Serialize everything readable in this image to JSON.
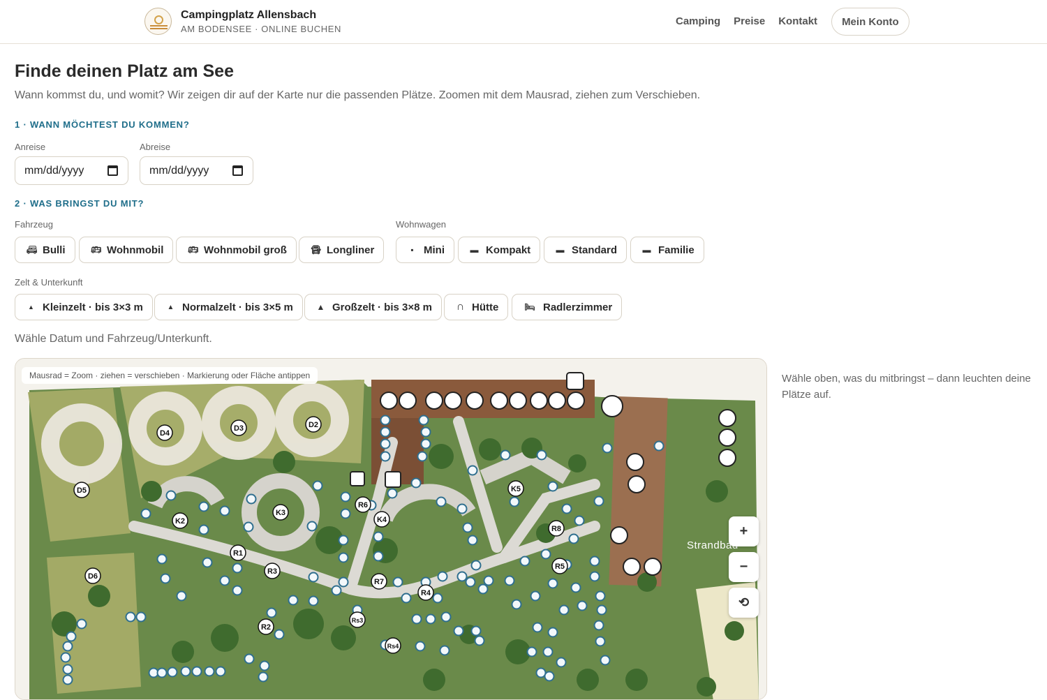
{
  "header": {
    "title": "Campingplatz Allensbach",
    "subtitle": "AM BODENSEE · ONLINE BUCHEN",
    "nav": [
      "Camping",
      "Preise",
      "Kontakt"
    ],
    "account_label": "Mein Konto"
  },
  "main": {
    "title": "Finde deinen Platz am See",
    "intro": "Wann kommst du, und womit? Wir zeigen dir auf der Karte nur die passenden Plätze. Zoomen mit dem Mausrad, ziehen zum Verschieben.",
    "step1": "1 · WANN MÖCHTEST DU KOMMEN?",
    "arrival_label": "Anreise",
    "departure_label": "Abreise",
    "arrival_value": "mm/dd/yyyy",
    "departure_value": "mm/dd/yyyy",
    "step2": "2 · WAS BRINGST DU MIT?",
    "vehicle_label": "Fahrzeug",
    "vehicles": [
      "Bulli",
      "Wohnmobil",
      "Wohnmobil groß",
      "Longliner"
    ],
    "caravan_label": "Wohnwagen",
    "caravans": [
      "Mini",
      "Kompakt",
      "Standard",
      "Familie"
    ],
    "tent_label": "Zelt & Unterkunft",
    "tents": [
      "Kleinzelt · bis 3×3 m",
      "Normalzelt · bis 3×5 m",
      "Großzelt · bis 3×8 m",
      "Hütte",
      "Radlerzimmer"
    ],
    "status": "Wähle Datum und Fahrzeug/Unterkunft.",
    "side_hint": "Wähle oben, was du mitbringst – dann leuchten deine Plätze auf."
  },
  "map": {
    "tip": "Mausrad = Zoom · ziehen = verschieben · Markierung oder Fläche antippen",
    "zoom_in": "+",
    "zoom_out": "−",
    "reset": "⟲",
    "area_label": "Strandbad",
    "zones": [
      "D5",
      "D4",
      "D3",
      "D2",
      "D6",
      "K2",
      "K3",
      "K4",
      "K5",
      "R1",
      "R2",
      "R3",
      "R4",
      "R5",
      "R6",
      "R7",
      "R8",
      "Rs3",
      "Rs4"
    ],
    "colors": {
      "grass": "#6f8f4e",
      "meadow": "#a6ad6a",
      "path": "#dedcd6",
      "building": "#8a5a3c",
      "marker": "#2f6f8f"
    }
  }
}
